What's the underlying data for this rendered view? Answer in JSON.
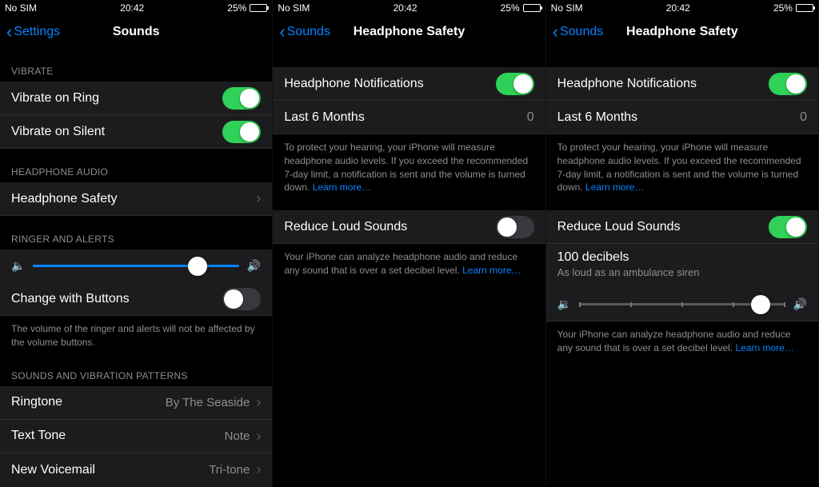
{
  "status": {
    "carrier": "No SIM",
    "time": "20:42",
    "battery": "25%"
  },
  "screens": [
    {
      "back": "Settings",
      "title": "Sounds",
      "sections": {
        "vibrate_header": "Vibrate",
        "vibrate_on_ring": "Vibrate on Ring",
        "vibrate_on_silent": "Vibrate on Silent",
        "headphone_audio_header": "Headphone Audio",
        "headphone_safety": "Headphone Safety",
        "ringer_alerts_header": "Ringer and Alerts",
        "change_with_buttons": "Change with Buttons",
        "ringer_footer": "The volume of the ringer and alerts will not be affected by the volume buttons.",
        "sounds_patterns_header": "Sounds and Vibration Patterns",
        "ringtone": "Ringtone",
        "ringtone_value": "By The Seaside",
        "text_tone": "Text Tone",
        "text_tone_value": "Note",
        "new_voicemail": "New Voicemail",
        "new_voicemail_value": "Tri-tone"
      },
      "toggles": {
        "vibrate_on_ring": true,
        "vibrate_on_silent": true,
        "change_with_buttons": false
      },
      "slider": {
        "position": 0.8
      }
    },
    {
      "back": "Sounds",
      "title": "Headphone Safety",
      "rows": {
        "headphone_notifications": "Headphone Notifications",
        "last_6_months": "Last 6 Months",
        "last_6_months_value": "0",
        "protect_footer": "To protect your hearing, your iPhone will measure headphone audio levels. If you exceed the recommended 7-day limit, a notification is sent and the volume is turned down.",
        "learn_more": "Learn more…",
        "reduce_loud": "Reduce Loud Sounds",
        "reduce_footer": "Your iPhone can analyze headphone audio and reduce any sound that is over a set decibel level."
      },
      "toggles": {
        "headphone_notifications": true,
        "reduce_loud": false
      }
    },
    {
      "back": "Sounds",
      "title": "Headphone Safety",
      "rows": {
        "headphone_notifications": "Headphone Notifications",
        "last_6_months": "Last 6 Months",
        "last_6_months_value": "0",
        "protect_footer": "To protect your hearing, your iPhone will measure headphone audio levels. If you exceed the recommended 7-day limit, a notification is sent and the volume is turned down.",
        "learn_more": "Learn more…",
        "reduce_loud": "Reduce Loud Sounds",
        "decibels": "100 decibels",
        "decibels_sub": "As loud as an ambulance siren",
        "reduce_footer": "Your iPhone can analyze headphone audio and reduce any sound that is over a set decibel level."
      },
      "toggles": {
        "headphone_notifications": true,
        "reduce_loud": true
      },
      "slider": {
        "position": 0.88
      }
    }
  ]
}
